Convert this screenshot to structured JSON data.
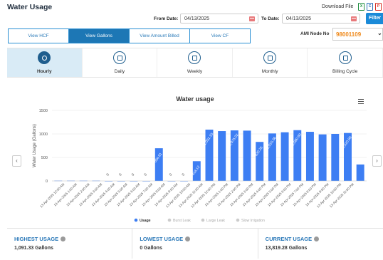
{
  "page_title": "Water Usage",
  "download_label": "Download File",
  "download_icons": [
    {
      "name": "excel-icon",
      "glyph": "X",
      "color": "#1e8e3e"
    },
    {
      "name": "csv-icon",
      "glyph": "C",
      "color": "#2a6fb8"
    },
    {
      "name": "pdf-icon",
      "glyph": "P",
      "color": "#d93025"
    }
  ],
  "from_date": {
    "label": "From Date:",
    "value": "04/13/2025"
  },
  "to_date": {
    "label": "To Date:",
    "value": "04/13/2025"
  },
  "filter_label": "Filter",
  "view_tabs": [
    {
      "label": "View HCF",
      "active": false
    },
    {
      "label": "View Gallons",
      "active": true
    },
    {
      "label": "View Amount Billed",
      "active": false
    },
    {
      "label": "View CF",
      "active": false
    }
  ],
  "ami": {
    "label": "AMI Node No",
    "value": "98001109",
    "arrow": "⌄"
  },
  "periods": [
    {
      "label": "Hourly",
      "icon": "clock-icon",
      "active": true
    },
    {
      "label": "Daily",
      "icon": "calendar-day-icon",
      "active": false
    },
    {
      "label": "Weekly",
      "icon": "calendar-week-icon",
      "active": false
    },
    {
      "label": "Monthly",
      "icon": "calendar-month-icon",
      "active": false
    },
    {
      "label": "Billing Cycle",
      "icon": "bill-icon",
      "active": false
    }
  ],
  "nav": {
    "prev": "‹",
    "next": "›"
  },
  "colors": {
    "bar": "#3d7ef3",
    "accent": "#1d77b5",
    "label_fill": "#ffffff"
  },
  "chart_data": {
    "type": "bar",
    "title": "Water usage",
    "ylabel": "Water Usage (Gallons)",
    "ylim": [
      0,
      1500
    ],
    "yticks": [
      0,
      500,
      1000,
      1500
    ],
    "categories": [
      "13-Apr-2025 12:00 AM",
      "13-Apr-2025 1:00 AM",
      "13-Apr-2025 2:00 AM",
      "13-Apr-2025 3:00 AM",
      "13-Apr-2025 4:00 AM",
      "13-Apr-2025 5:00 AM",
      "13-Apr-2025 6:00 AM",
      "13-Apr-2025 7:00 AM",
      "13-Apr-2025 8:00 AM",
      "13-Apr-2025 9:00 AM",
      "13-Apr-2025 10:00 AM",
      "13-Apr-2025 11:00 AM",
      "13-Apr-2025 12:00 PM",
      "13-Apr-2025 1:00 PM",
      "13-Apr-2025 2:00 PM",
      "13-Apr-2025 3:00 PM",
      "13-Apr-2025 4:00 PM",
      "13-Apr-2025 5:00 PM",
      "13-Apr-2025 6:00 PM",
      "13-Apr-2025 7:00 PM",
      "13-Apr-2025 8:00 PM",
      "13-Apr-2025 9:00 PM",
      "13-Apr-2025 10:00 PM",
      "13-Apr-2025 11:00 PM"
    ],
    "values": [
      6,
      6,
      6,
      6,
      0,
      0,
      0,
      0,
      695,
      0,
      0,
      420,
      1091.33,
      1060,
      1075,
      1070,
      830,
      1010,
      1035,
      1080,
      1045,
      990,
      1000,
      1020,
      350
    ],
    "data_labels": [
      "",
      "",
      "",
      "",
      "0",
      "0",
      "0",
      "0",
      "694.81",
      "0",
      "0",
      "418.12",
      "1,091.33",
      "",
      "1,075.02",
      "",
      "830.25",
      "1,010.36",
      "",
      "1,080.50",
      "",
      "",
      "",
      "1,020.89",
      ""
    ],
    "legend": [
      {
        "label": "Usage",
        "active": true
      },
      {
        "label": "Burst Leak",
        "active": false
      },
      {
        "label": "Large Leak",
        "active": false
      },
      {
        "label": "Slow Irrigation",
        "active": false
      }
    ],
    "legend_position": "bottom"
  },
  "stats": [
    {
      "label": "HIGHEST USAGE",
      "value": "1,091.33 Gallons"
    },
    {
      "label": "LOWEST USAGE",
      "value": "0 Gallons"
    },
    {
      "label": "CURRENT USAGE",
      "value": "13,819.28 Gallons"
    }
  ]
}
